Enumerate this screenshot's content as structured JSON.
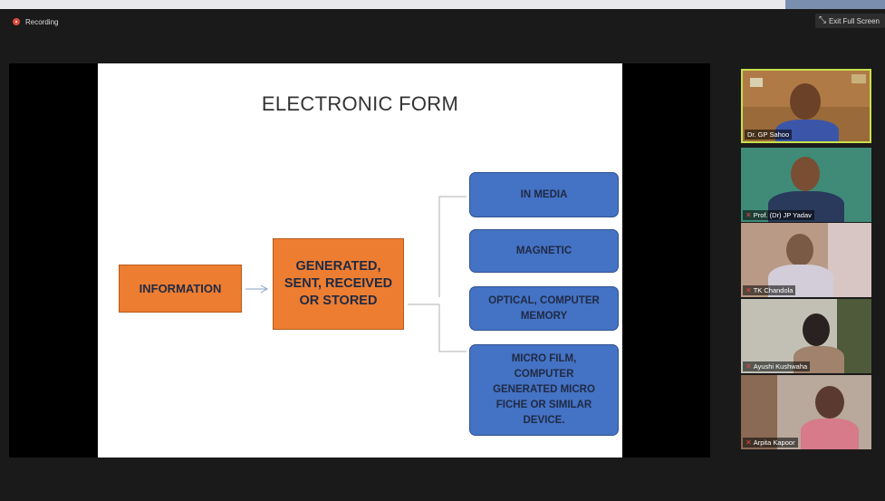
{
  "recording": {
    "label": "Recording"
  },
  "exit_fullscreen": {
    "label": "Exit Full Screen"
  },
  "slide": {
    "title": "ELECTRONIC FORM",
    "source_box": "INFORMATION",
    "middle_box": "GENERATED, SENT, RECEIVED OR STORED",
    "targets": [
      "IN MEDIA",
      "MAGNETIC",
      "OPTICAL, COMPUTER MEMORY",
      "MICRO FILM, COMPUTER GENERATED MICRO FICHE OR SIMILAR DEVICE."
    ]
  },
  "participants": [
    {
      "name": "Dr. GP Sahoo",
      "muted": false,
      "active": true
    },
    {
      "name": "Prof. (Dr) JP Yadav",
      "muted": true,
      "active": false
    },
    {
      "name": "TK Chandola",
      "muted": true,
      "active": false
    },
    {
      "name": "Ayushi Kushwaha",
      "muted": true,
      "active": false
    },
    {
      "name": "Arpita Kapoor",
      "muted": true,
      "active": false
    }
  ],
  "colors": {
    "orange_box": "#ed7d31",
    "blue_box": "#4472c4",
    "active_speaker_border": "#c8e04a",
    "muted_icon": "#e24b3b"
  }
}
